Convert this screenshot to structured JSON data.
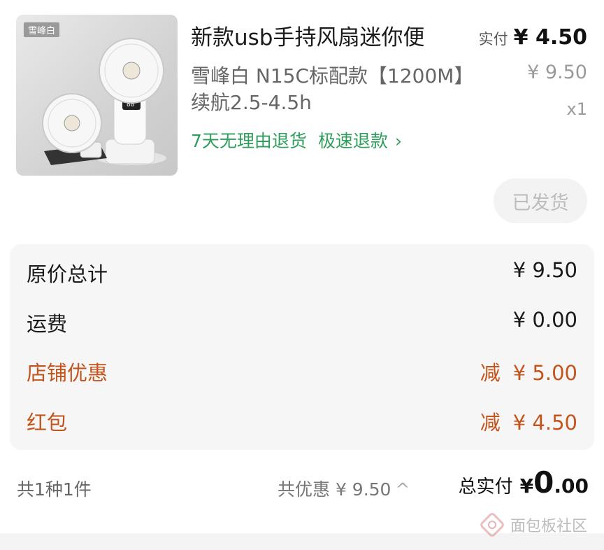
{
  "product": {
    "thumbnail_tag": "雪峰白",
    "title": "新款usb手持风扇迷你便",
    "spec": "雪峰白 N15C标配款【1200M】续航2.5-4.5h",
    "guarantee_1": "7天无理由退货",
    "guarantee_2": "极速退款",
    "guarantee_chevron": "›",
    "paid_label": "实付",
    "paid_amount": "¥ 4.50",
    "original_price": "¥ 9.50",
    "quantity": "x1",
    "status_button": "已发货"
  },
  "summary": {
    "rows": [
      {
        "label": "原价总计",
        "value": "¥ 9.50",
        "prefix": ""
      },
      {
        "label": "运费",
        "value": "¥ 0.00",
        "prefix": ""
      },
      {
        "label": "店铺优惠",
        "value": "¥ 5.00",
        "prefix": "减"
      },
      {
        "label": "红包",
        "value": "¥ 4.50",
        "prefix": "减"
      }
    ]
  },
  "footer": {
    "count": "共1种1件",
    "discount": "共优惠 ¥ 9.50",
    "discount_toggle": "^",
    "total_label": "总实付",
    "total_yen": "¥",
    "total_int": "0",
    "total_dec": ".00"
  },
  "watermark": {
    "text": "面包板社区"
  },
  "colors": {
    "green": "#2f9d5b",
    "orange": "#c4541c",
    "panel": "#f6f6f6"
  },
  "icons": [
    "handheld-fan-product-image",
    "chevron-right-icon",
    "chevron-up-icon",
    "watermark-logo-icon"
  ]
}
